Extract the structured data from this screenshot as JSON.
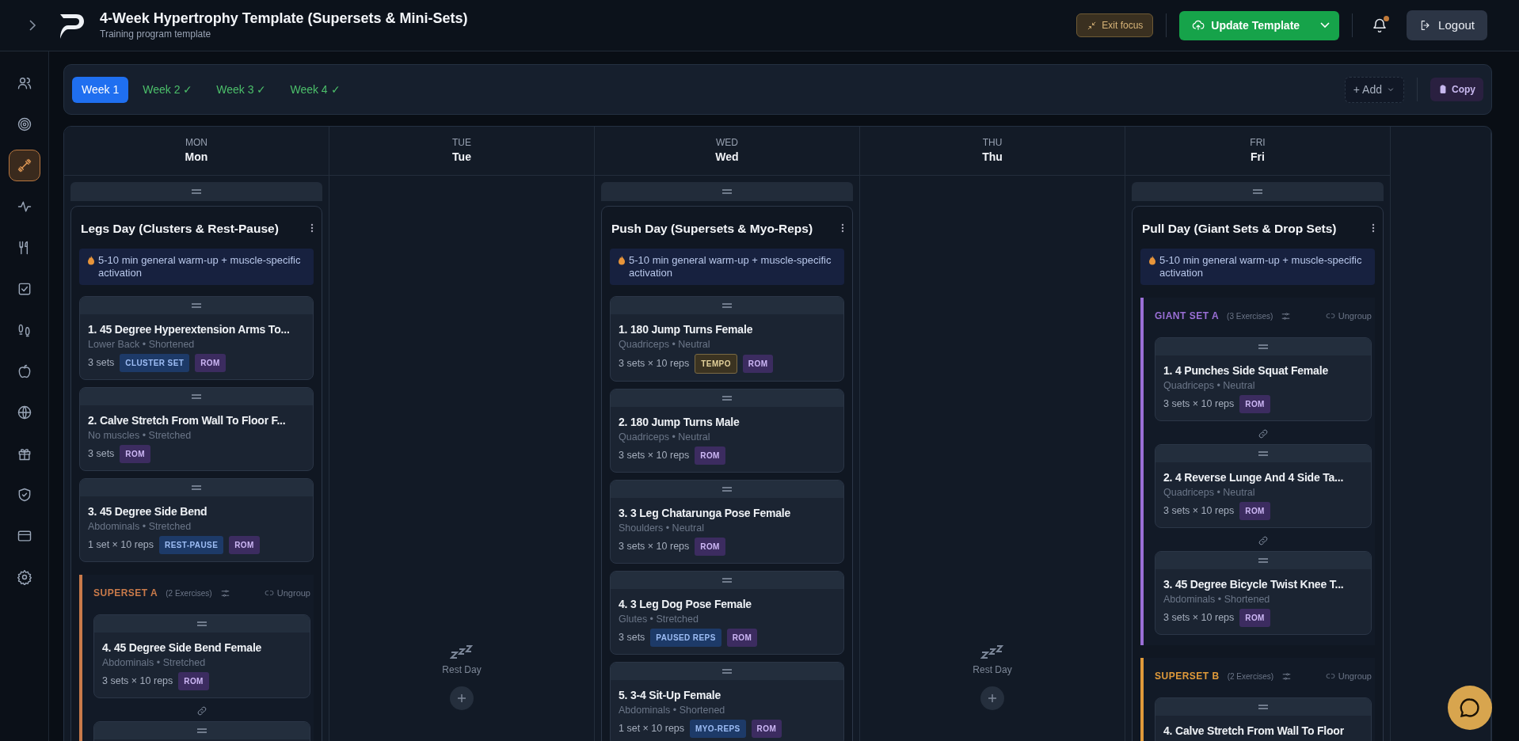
{
  "header": {
    "title": "4-Week Hypertrophy Template (Supersets & Mini-Sets)",
    "subtitle": "Training program template",
    "exit_focus": "Exit focus",
    "update": "Update Template",
    "logout": "Logout",
    "notification_unread": true
  },
  "sidebar": {
    "items": [
      {
        "selected": false
      },
      {
        "selected": false
      },
      {
        "selected": true
      },
      {
        "selected": false
      },
      {
        "selected": false
      },
      {
        "selected": false
      },
      {
        "selected": false
      },
      {
        "selected": false
      },
      {
        "selected": false
      },
      {
        "selected": false
      },
      {
        "selected": false
      },
      {
        "selected": false
      }
    ]
  },
  "weeks": {
    "tabs": [
      {
        "label": "Week 1",
        "selected": true
      },
      {
        "label": "Week 2 ✓",
        "selected": false
      },
      {
        "label": "Week 3 ✓",
        "selected": false
      },
      {
        "label": "Week 4 ✓",
        "selected": false
      }
    ],
    "add": "+ Add",
    "copy": "Copy"
  },
  "days": [
    {
      "abbr": "MON",
      "name": "Mon",
      "kind": "workout",
      "workout": {
        "title": "Legs Day (Clusters & Rest-Pause)",
        "warmup": "5-10 min general warm-up + muscle-specific activation",
        "items": [
          {
            "kind": "exercise",
            "title": "1. 45 Degree Hyperextension Arms To...",
            "meta": "Lower Back • Shortened",
            "sets": "3 sets",
            "tags": [
              {
                "label": "CLUSTER SET",
                "kind": "technique"
              },
              {
                "label": "ROM",
                "kind": "rom"
              }
            ]
          },
          {
            "kind": "exercise",
            "title": "2. Calve Stretch From Wall To Floor F...",
            "meta": "No muscles • Stretched",
            "sets": "3 sets",
            "tags": [
              {
                "label": "ROM",
                "kind": "rom"
              }
            ]
          },
          {
            "kind": "exercise",
            "title": "3. 45 Degree Side Bend",
            "meta": "Abdominals • Stretched",
            "sets": "1 set × 10 reps",
            "tags": [
              {
                "label": "REST-PAUSE",
                "kind": "technique"
              },
              {
                "label": "ROM",
                "kind": "rom"
              }
            ]
          },
          {
            "kind": "group",
            "label": "SUPERSET A",
            "count": "(2 Exercises)",
            "ungroup": "Ungroup",
            "color": "#c97a4a",
            "exercises": [
              {
                "title": "4. 45 Degree Side Bend Female",
                "meta": "Abdominals • Stretched",
                "sets": "3 sets × 10 reps",
                "tags": [
                  {
                    "label": "ROM",
                    "kind": "rom"
                  }
                ]
              },
              {
                "cut_off": true
              }
            ]
          }
        ]
      }
    },
    {
      "abbr": "TUE",
      "name": "Tue",
      "kind": "rest",
      "rest_label": "Rest Day"
    },
    {
      "abbr": "WED",
      "name": "Wed",
      "kind": "workout",
      "workout": {
        "title": "Push Day (Supersets & Myo-Reps)",
        "warmup": "5-10 min general warm-up + muscle-specific activation",
        "items": [
          {
            "kind": "exercise",
            "title": "1. 180 Jump Turns Female",
            "meta": "Quadriceps • Neutral",
            "sets": "3 sets × 10 reps",
            "tags": [
              {
                "label": "TEMPO",
                "kind": "tempo"
              },
              {
                "label": "ROM",
                "kind": "rom"
              }
            ]
          },
          {
            "kind": "exercise",
            "title": "2. 180 Jump Turns Male",
            "meta": "Quadriceps • Neutral",
            "sets": "3 sets × 10 reps",
            "tags": [
              {
                "label": "ROM",
                "kind": "rom"
              }
            ]
          },
          {
            "kind": "exercise",
            "title": "3. 3 Leg Chatarunga Pose Female",
            "meta": "Shoulders • Neutral",
            "sets": "3 sets × 10 reps",
            "tags": [
              {
                "label": "ROM",
                "kind": "rom"
              }
            ]
          },
          {
            "kind": "exercise",
            "title": "4. 3 Leg Dog Pose Female",
            "meta": "Glutes • Stretched",
            "sets": "3 sets",
            "tags": [
              {
                "label": "PAUSED REPS",
                "kind": "technique"
              },
              {
                "label": "ROM",
                "kind": "rom"
              }
            ]
          },
          {
            "kind": "exercise",
            "title": "5. 3-4 Sit-Up Female",
            "meta": "Abdominals • Shortened",
            "sets": "1 set × 10 reps",
            "tags": [
              {
                "label": "MYO-REPS",
                "kind": "technique"
              },
              {
                "label": "ROM",
                "kind": "rom"
              }
            ]
          }
        ]
      }
    },
    {
      "abbr": "THU",
      "name": "Thu",
      "kind": "rest",
      "rest_label": "Rest Day"
    },
    {
      "abbr": "FRI",
      "name": "Fri",
      "kind": "workout",
      "workout": {
        "title": "Pull Day (Giant Sets & Drop Sets)",
        "warmup": "5-10 min general warm-up + muscle-specific activation",
        "items": [
          {
            "kind": "group",
            "label": "GIANT SET A",
            "count": "(3 Exercises)",
            "ungroup": "Ungroup",
            "color": "#9a6fd6",
            "exercises": [
              {
                "title": "1. 4 Punches Side Squat Female",
                "meta": "Quadriceps • Neutral",
                "sets": "3 sets × 10 reps",
                "tags": [
                  {
                    "label": "ROM",
                    "kind": "rom"
                  }
                ]
              },
              {
                "title": "2. 4 Reverse Lunge And 4 Side Ta...",
                "meta": "Quadriceps • Neutral",
                "sets": "3 sets × 10 reps",
                "tags": [
                  {
                    "label": "ROM",
                    "kind": "rom"
                  }
                ]
              },
              {
                "title": "3. 45 Degree Bicycle Twist Knee T...",
                "meta": "Abdominals • Shortened",
                "sets": "3 sets × 10 reps",
                "tags": [
                  {
                    "label": "ROM",
                    "kind": "rom"
                  }
                ]
              }
            ]
          },
          {
            "kind": "group",
            "label": "SUPERSET B",
            "count": "(2 Exercises)",
            "ungroup": "Ungroup",
            "color": "#e09a3a",
            "exercises": [
              {
                "title": "4. Calve Stretch From Wall To Floor"
              }
            ]
          }
        ]
      }
    }
  ]
}
